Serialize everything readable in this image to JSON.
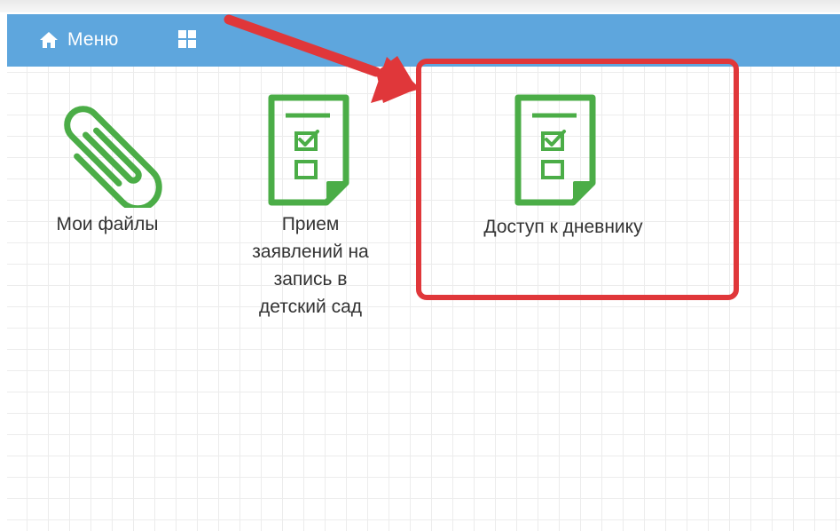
{
  "header": {
    "menu_label": "Меню",
    "menu_icon": "home-icon",
    "apps_icon": "grid-icon",
    "bar_color": "#5ea6dd"
  },
  "tiles": [
    {
      "label": "Мои файлы",
      "icon": "paperclip-icon"
    },
    {
      "label_lines": [
        "Прием",
        "заявлений на",
        "запись в",
        "детский сад"
      ],
      "icon": "checklist-document-icon"
    },
    {
      "label": "Доступ к дневнику",
      "icon": "checklist-document-icon"
    }
  ],
  "annotation": {
    "highlight_color": "#e0373a",
    "arrow_color": "#e0373a",
    "icon_color": "#4bad47"
  }
}
